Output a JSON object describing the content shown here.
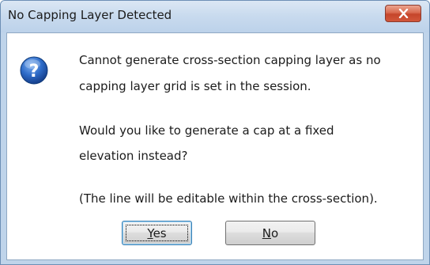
{
  "window": {
    "title": "No Capping Layer Detected",
    "close_icon": "close-icon",
    "close_button_color": "#c5452a"
  },
  "content": {
    "icon": "question-icon",
    "icon_color": "#1e58b8",
    "message_line_1": "Cannot generate cross-section capping layer as no",
    "message_line_2": "capping layer grid is set in the session.",
    "question_line_1": "Would you like to generate a cap at a fixed",
    "question_line_2": "elevation instead?",
    "note": "(The line will be editable within the cross-section)."
  },
  "buttons": {
    "yes": {
      "mnemonic": "Y",
      "rest": "es"
    },
    "no": {
      "mnemonic": "N",
      "rest": "o"
    }
  }
}
